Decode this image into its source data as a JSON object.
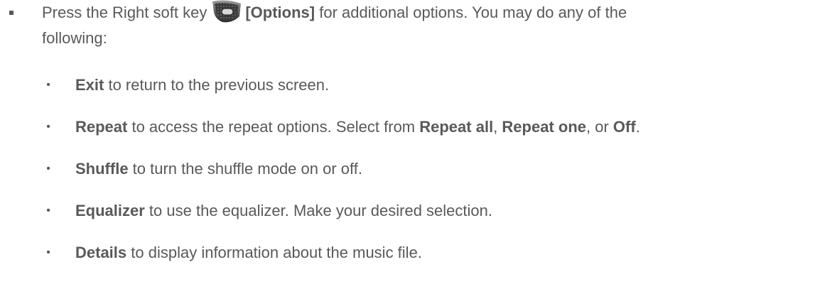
{
  "main": {
    "prefix": "Press the Right soft key",
    "key_label": "[Options]",
    "suffix": "for additional options. You may do any of the",
    "line2": "following:",
    "icon": "right-soft-key-icon"
  },
  "options": [
    {
      "term": "Exit",
      "text": " to return to the previous screen."
    },
    {
      "term": "Repeat",
      "text": " to access the repeat options. Select from ",
      "choice1": "Repeat all",
      "sep1": ", ",
      "choice2": "Repeat one",
      "sep2": ", or ",
      "choice3": "Off",
      "end": "."
    },
    {
      "term": "Shuffle",
      "text": " to turn the shuffle mode on or off."
    },
    {
      "term": "Equalizer",
      "text": " to use the equalizer. Make your desired selection."
    },
    {
      "term": "Details",
      "text": " to display information about the music file."
    }
  ],
  "bullet_char": "•"
}
